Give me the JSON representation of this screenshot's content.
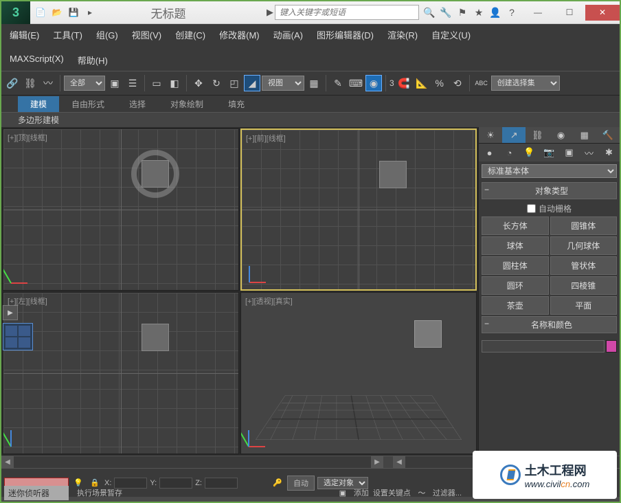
{
  "title": "无标题",
  "search_placeholder": "键入关键字或短语",
  "menu": {
    "row1": [
      "编辑(E)",
      "工具(T)",
      "组(G)",
      "视图(V)",
      "创建(C)",
      "修改器(M)",
      "动画(A)",
      "图形编辑器(D)",
      "渲染(R)",
      "自定义(U)"
    ],
    "row2": [
      "MAXScript(X)",
      "帮助(H)"
    ]
  },
  "toolbar": {
    "dd_all": "全部",
    "dd_view": "视图",
    "spinner": "3",
    "dd_set": "创建选择集"
  },
  "ribbon": {
    "tabs": [
      "建模",
      "自由形式",
      "选择",
      "对象绘制",
      "填充"
    ],
    "panel_label": "多边形建模"
  },
  "viewports": {
    "top": "[+][顶][线框]",
    "front": "[+][前][线框]",
    "left": "[+][左][线框]",
    "persp": "[+][透视][真实]"
  },
  "cmd": {
    "dd_category": "标准基本体",
    "rollout_type": "对象类型",
    "autogrid": "自动栅格",
    "primitives": [
      "长方体",
      "圆锥体",
      "球体",
      "几何球体",
      "圆柱体",
      "管状体",
      "圆环",
      "四棱锥",
      "茶壶",
      "平面"
    ],
    "rollout_name": "名称和颜色"
  },
  "status": {
    "x": "X:",
    "y": "Y:",
    "z": "Z:",
    "auto": "自动",
    "keymode": "选定对象",
    "setkey": "设置关键点",
    "filter": "过滤器...",
    "add": "添加",
    "listener": "迷你侦听器",
    "prompt": "执行场景暂存"
  },
  "watermark": {
    "name": "土木工程网",
    "url_pre": "www.civil",
    "url_cn": "cn",
    "url_post": ".com"
  }
}
